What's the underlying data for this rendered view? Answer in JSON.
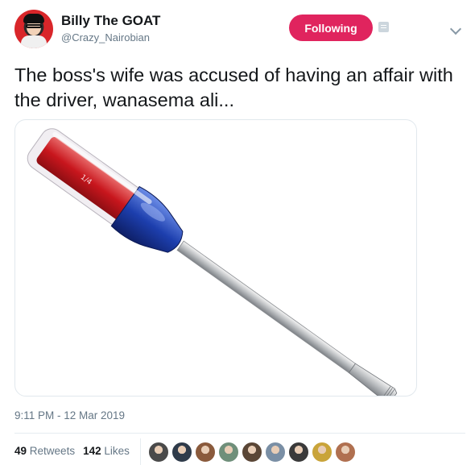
{
  "tweet": {
    "author": {
      "display_name": "Billy The GOAT",
      "handle": "@Crazy_Nairobian"
    },
    "follow_button_label": "Following",
    "text": "The boss's wife was accused of having an affair with the driver, wanasema ali...",
    "media": {
      "description_icon": "screwdriver-image",
      "handle_marking": "1/4"
    },
    "timestamp": "9:11 PM - 12 Mar 2019",
    "stats": {
      "retweets_count": "49",
      "retweets_label": "Retweets",
      "likes_count": "142",
      "likes_label": "Likes"
    },
    "likers": [
      {
        "name": "liker-avatar",
        "color": "#4a4a4a"
      },
      {
        "name": "liker-avatar",
        "color": "#2f3b4a"
      },
      {
        "name": "liker-avatar",
        "color": "#8a5a3c"
      },
      {
        "name": "liker-avatar",
        "color": "#6f8f7a"
      },
      {
        "name": "liker-avatar",
        "color": "#5a4636"
      },
      {
        "name": "liker-avatar",
        "color": "#7a8fa5"
      },
      {
        "name": "liker-avatar",
        "color": "#3a3a3a"
      },
      {
        "name": "liker-avatar",
        "color": "#c9a43a"
      },
      {
        "name": "liker-avatar",
        "color": "#b07050"
      }
    ]
  },
  "colors": {
    "follow_button_bg": "#e0245e",
    "muted_text": "#657786",
    "primary_text": "#14171a"
  }
}
